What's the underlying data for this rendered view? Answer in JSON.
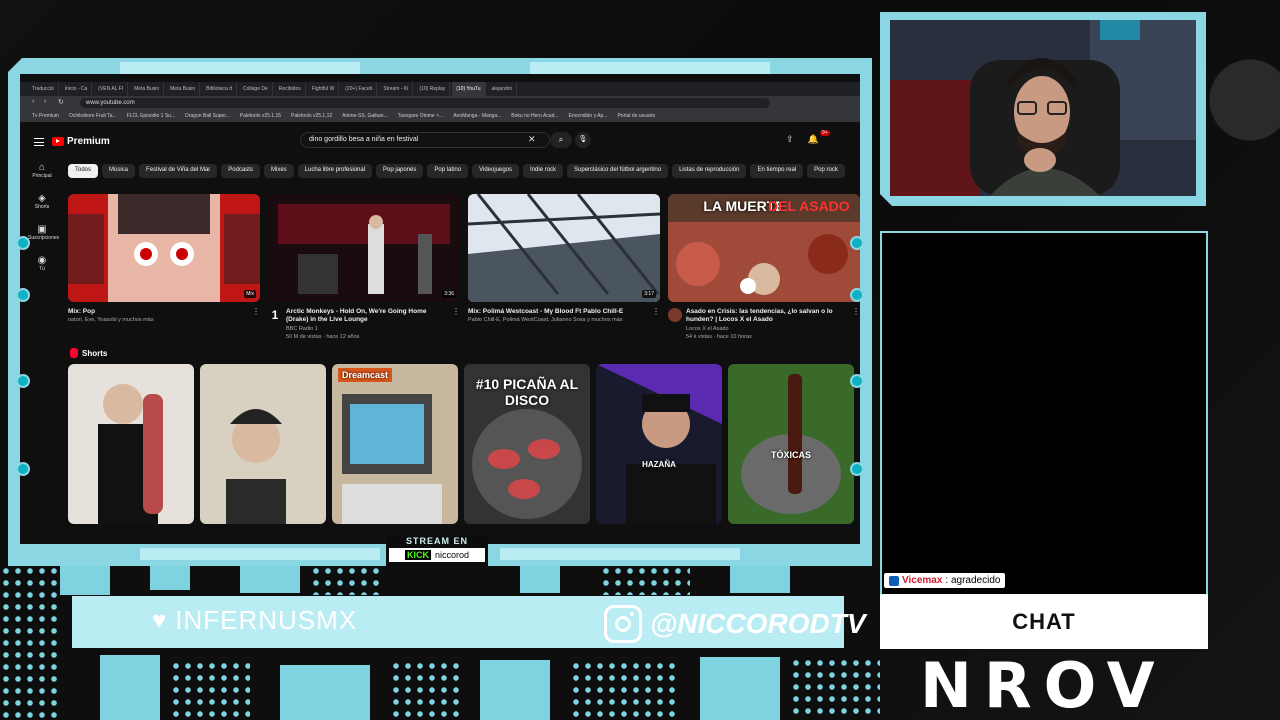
{
  "browser": {
    "tabs": [
      "Traducció",
      "Inicio - Ca",
      "(VEN AL FI",
      "Meta Busin",
      "Meta Busin",
      "Biblioteca d",
      "Collage De",
      "Recibidos",
      "Fightful W",
      "(20+) Faceb",
      "Stream - Ki",
      "(10) Replay",
      "(10) YouTu",
      "alejandro"
    ],
    "url": "www.youtube.com",
    "bookmarks": [
      "Tv Premium",
      "Ochikobore Fruit Ta...",
      "FLCL Episodio 1 Su...",
      "Dragon Ball Super...",
      "Paletools v25.1.15",
      "Paletools v25.1.12",
      "Anime-SS, Gaiban...",
      "Tasogare Otome ×...",
      "AnoManga - Manga...",
      "Boku no Hero Acad...",
      "Encendido y Ap...",
      "Portal de usuario"
    ]
  },
  "youtube": {
    "brand": "Premium",
    "search_value": "dino gordillo besa a niña en festival",
    "nav": [
      {
        "icon": "home-icon",
        "glyph": "⌂",
        "label": "Principal"
      },
      {
        "icon": "shorts-icon",
        "glyph": "◈",
        "label": "Shorts"
      },
      {
        "icon": "subscriptions-icon",
        "glyph": "▣",
        "label": "Suscripciones"
      },
      {
        "icon": "you-icon",
        "glyph": "◉",
        "label": "Tú"
      }
    ],
    "chips": [
      "Todos",
      "Música",
      "Festival de Viña del Mar",
      "Podcasts",
      "Mixes",
      "Lucha libre profesional",
      "Pop japonés",
      "Pop latino",
      "Videojuegos",
      "Indie rock",
      "Superclásico del fútbol argentino",
      "Listas de reproducción",
      "En tiempo real",
      "Pop rock"
    ],
    "videos": [
      {
        "title": "Mix: Pop",
        "meta1": "natori, Eve, Yoasobi y muchos más",
        "meta2": "",
        "duration": "Mix",
        "rank": ""
      },
      {
        "title": "Arctic Monkeys - Hold On, We're Going Home (Drake) in the Live Lounge",
        "meta1": "BBC Radio 1",
        "meta2": "50 M de vistas · hace 12 años",
        "duration": "3:36",
        "rank": "1"
      },
      {
        "title": "Mix: Polimá Westcoast - My Blood Ft Pablo Chill-E",
        "meta1": "Pablo Chill-E, Polimá WestCoast, Julianno Sosa y muchos más",
        "meta2": "",
        "duration": "3:17",
        "rank": ""
      },
      {
        "title": "Asado en Crisis: las tendencias, ¿lo salvan o lo hunden? | Locos X el Asado",
        "meta1": "Locos X el Asado",
        "meta2": "54 k vistas · hace 10 horas",
        "duration": "",
        "rank": ""
      }
    ],
    "thumb4_caption_1": "LA MUERTE",
    "thumb4_caption_2": "DEL ASADO",
    "shorts_title": "Shorts",
    "shorts": [
      {
        "caption": ""
      },
      {
        "caption": ""
      },
      {
        "caption": "Dreamcast"
      },
      {
        "caption": "#10 PICAÑA AL DISCO"
      },
      {
        "caption": "HAZAÑA"
      },
      {
        "caption": "TÓXICAS"
      }
    ]
  },
  "overlay": {
    "stream_on": "STREAM EN",
    "kick_brand": "KICK",
    "kick_channel": "niccorod",
    "left_handle": "INFERNUSMX",
    "right_handle": "@NICCORODTV",
    "chat_user": "Vicemax",
    "chat_text": ": agradecido",
    "chat_title": "CHAT",
    "logo": "NROV"
  },
  "colors": {
    "frame": "#8ad6e3",
    "frame_light": "#b9ecf3",
    "accent": "#0fb1c5",
    "yt_red": "#ff0000",
    "kick_green": "#53fc18"
  }
}
